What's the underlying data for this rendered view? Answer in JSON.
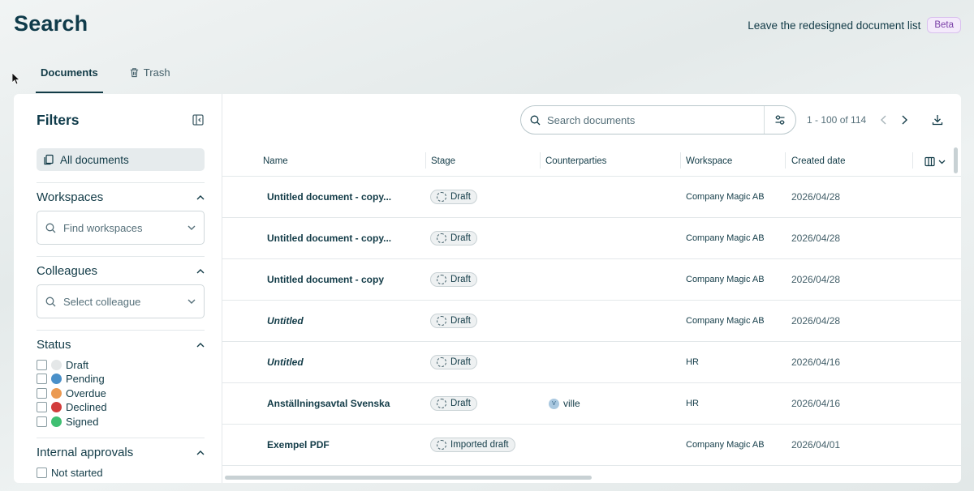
{
  "page": {
    "title": "Search",
    "leave_link": "Leave the redesigned document list",
    "beta_badge": "Beta"
  },
  "tabs": [
    {
      "label": "Documents",
      "active": true,
      "icon": "none"
    },
    {
      "label": "Trash",
      "active": false,
      "icon": "trash-icon"
    }
  ],
  "filters": {
    "title": "Filters",
    "all_documents": "All documents",
    "workspaces": {
      "title": "Workspaces",
      "placeholder": "Find workspaces"
    },
    "colleagues": {
      "title": "Colleagues",
      "placeholder": "Select colleague"
    },
    "status": {
      "title": "Status",
      "items": [
        {
          "label": "Draft",
          "color": "#e4e7e8"
        },
        {
          "label": "Pending",
          "color": "#4a90c9"
        },
        {
          "label": "Overdue",
          "color": "#eb9a52"
        },
        {
          "label": "Declined",
          "color": "#d23c3c"
        },
        {
          "label": "Signed",
          "color": "#3fbf72"
        }
      ]
    },
    "internal_approvals": {
      "title": "Internal approvals",
      "items": [
        {
          "label": "Not started"
        }
      ]
    }
  },
  "search": {
    "placeholder": "Search documents"
  },
  "pagination": {
    "text": "1 - 100 of 114"
  },
  "table": {
    "columns": [
      "Name",
      "Stage",
      "Counterparties",
      "Workspace",
      "Created date"
    ],
    "rows": [
      {
        "name": "Untitled document - copy...",
        "italic": false,
        "stage": "Draft",
        "counterparty": "",
        "avatar": "",
        "workspace": "Company Magic AB",
        "created": "2026/04/28"
      },
      {
        "name": "Untitled document - copy...",
        "italic": false,
        "stage": "Draft",
        "counterparty": "",
        "avatar": "",
        "workspace": "Company Magic AB",
        "created": "2026/04/28"
      },
      {
        "name": "Untitled document - copy",
        "italic": false,
        "stage": "Draft",
        "counterparty": "",
        "avatar": "",
        "workspace": "Company Magic AB",
        "created": "2026/04/28"
      },
      {
        "name": "Untitled",
        "italic": true,
        "stage": "Draft",
        "counterparty": "",
        "avatar": "",
        "workspace": "Company Magic AB",
        "created": "2026/04/28"
      },
      {
        "name": "Untitled",
        "italic": true,
        "stage": "Draft",
        "counterparty": "",
        "avatar": "",
        "workspace": "HR",
        "created": "2026/04/16"
      },
      {
        "name": "Anställningsavtal Svenska",
        "italic": false,
        "stage": "Draft",
        "counterparty": "ville",
        "avatar": "V",
        "workspace": "HR",
        "created": "2026/04/16"
      },
      {
        "name": "Exempel PDF",
        "italic": false,
        "stage": "Imported draft",
        "counterparty": "",
        "avatar": "",
        "workspace": "Company Magic AB",
        "created": "2026/04/01"
      }
    ]
  }
}
